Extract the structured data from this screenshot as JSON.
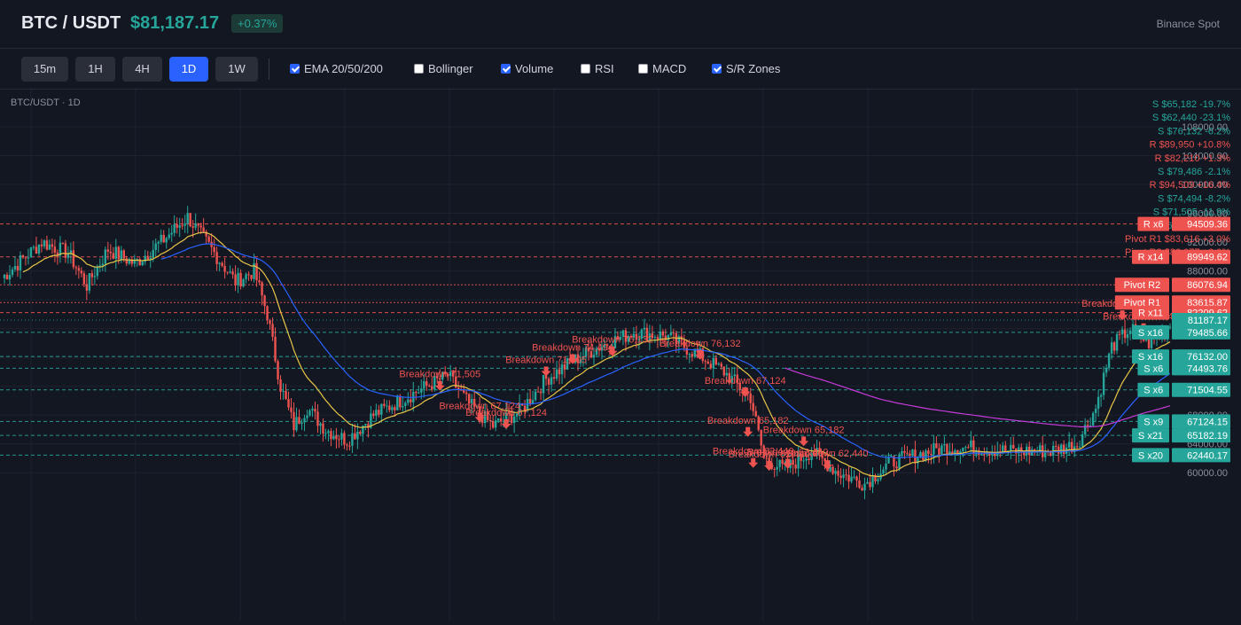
{
  "header": {
    "symbol": "BTC / USDT",
    "price": "$81,187.17",
    "change": "+0.37%",
    "exchange": "Binance Spot"
  },
  "toolbar": {
    "timeframes": [
      {
        "label": "15m",
        "active": false
      },
      {
        "label": "1H",
        "active": false
      },
      {
        "label": "4H",
        "active": false
      },
      {
        "label": "1D",
        "active": true
      },
      {
        "label": "1W",
        "active": false
      }
    ],
    "indicators": [
      {
        "label": "EMA 20/50/200",
        "checked": true
      },
      {
        "label": "Bollinger",
        "checked": false
      },
      {
        "label": "Volume",
        "checked": true
      },
      {
        "label": "RSI",
        "checked": false
      },
      {
        "label": "MACD",
        "checked": false
      },
      {
        "label": "S/R Zones",
        "checked": true
      }
    ]
  },
  "chart": {
    "title": "BTC/USDT · 1D",
    "colors": {
      "background": "#131722",
      "grid": "#1e2230",
      "up": "#26a69a",
      "down": "#ef5350",
      "ema20": "#e8c547",
      "ema50": "#2962ff",
      "ema200": "#c43bd8",
      "resistance": "#ef5350",
      "support": "#26a69a",
      "axis_text": "#8a8f9c",
      "current": "#26a69a"
    },
    "y_axis_ticks": [
      "108000.00",
      "104000.00",
      "100000.00",
      "96000.00",
      "92000.00",
      "88000.00",
      "84000.00",
      "80000.00",
      "76000.00",
      "72000.00",
      "68000.00",
      "64000.00",
      "60000.00"
    ],
    "current_price": "81187.17",
    "zone_notes": [
      {
        "text": "S $65,182 -19.7%",
        "kind": "support"
      },
      {
        "text": "S $62,440 -23.1%",
        "kind": "support"
      },
      {
        "text": "S $76,132 -6.2%",
        "kind": "support"
      },
      {
        "text": "R $89,950 +10.8%",
        "kind": "resistance"
      },
      {
        "text": "R $82,210 +1.3%",
        "kind": "resistance"
      },
      {
        "text": "S $79,486 -2.1%",
        "kind": "support"
      },
      {
        "text": "R $94,509 +16.4%",
        "kind": "resistance"
      },
      {
        "text": "S $74,494 -8.2%",
        "kind": "support"
      },
      {
        "text": "S $71,505 -11.9%",
        "kind": "support"
      },
      {
        "text": "S $67,124 -17.3%",
        "kind": "support"
      },
      {
        "text": "Pivot R1 $83,616 +3.0%",
        "kind": "resistance"
      },
      {
        "text": "Pivot R2 $86,077 +6.0%",
        "kind": "resistance"
      }
    ],
    "levels": [
      {
        "tag": "R x6",
        "value": "94509.36",
        "price": 94509.36,
        "kind": "resistance"
      },
      {
        "tag": "R x14",
        "value": "89949.62",
        "price": 89949.62,
        "kind": "resistance"
      },
      {
        "tag": "Pivot R2",
        "value": "86076.94",
        "price": 86076.94,
        "kind": "pivot"
      },
      {
        "tag": "Pivot R1",
        "value": "83615.87",
        "price": 83615.87,
        "kind": "pivot"
      },
      {
        "tag": "R x11",
        "value": "82209.62",
        "price": 82209.62,
        "kind": "resistance"
      },
      {
        "tag": "S x16",
        "value": "79485.66",
        "price": 79485.66,
        "kind": "support"
      },
      {
        "tag": "S x16",
        "value": "76132.00",
        "price": 76132.0,
        "kind": "support"
      },
      {
        "tag": "S x6",
        "value": "74493.76",
        "price": 74493.76,
        "kind": "support"
      },
      {
        "tag": "S x6",
        "value": "71504.55",
        "price": 71504.55,
        "kind": "support"
      },
      {
        "tag": "S x9",
        "value": "67124.15",
        "price": 67124.15,
        "kind": "support"
      },
      {
        "tag": "S x21",
        "value": "65182.19",
        "price": 65182.19,
        "kind": "support"
      },
      {
        "tag": "S x20",
        "value": "62440.17",
        "price": 62440.17,
        "kind": "support"
      }
    ],
    "breakdowns": [
      {
        "text": "Breakdown 71,505",
        "bar": 165,
        "price": 71505
      },
      {
        "text": "Breakdown 67,124",
        "bar": 180,
        "price": 67124
      },
      {
        "text": "Breakdown 67,124",
        "bar": 190,
        "price": 66200
      },
      {
        "text": "Breakdown 71,505",
        "bar": 205,
        "price": 73500
      },
      {
        "text": "Breakdown 74,494",
        "bar": 215,
        "price": 75200
      },
      {
        "text": "Breakdown 76,132",
        "bar": 230,
        "price": 76300
      },
      {
        "text": "Breakdown 76,132",
        "bar": 263,
        "price": 75800
      },
      {
        "text": "Breakdown 67,124",
        "bar": 280,
        "price": 70600
      },
      {
        "text": "Breakdown 65,182",
        "bar": 281,
        "price": 65100
      },
      {
        "text": "Breakdown 65,182",
        "bar": 302,
        "price": 63800
      },
      {
        "text": "Breakdown 62,440",
        "bar": 283,
        "price": 60800
      },
      {
        "text": "Breakdown 62,440",
        "bar": 289,
        "price": 60400
      },
      {
        "text": "Breakdown 62,440",
        "bar": 296,
        "price": 60700
      },
      {
        "text": "Breakdown 62,440",
        "bar": 311,
        "price": 60500
      },
      {
        "text": "Breakdown 82,210",
        "bar": 422,
        "price": 81300
      },
      {
        "text": "Breakdown 79,486",
        "bar": 430,
        "price": 79500
      }
    ]
  }
}
